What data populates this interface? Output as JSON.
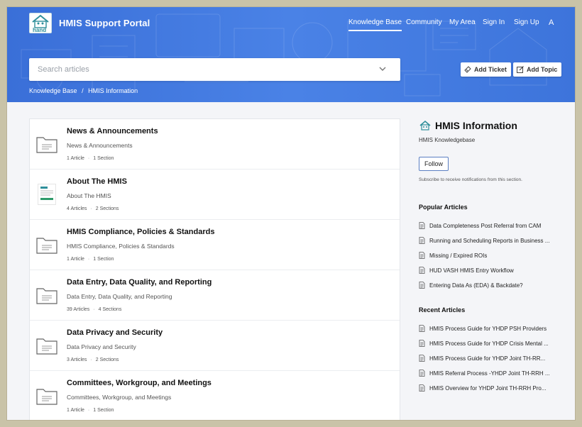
{
  "header": {
    "brand": "HMIS Support Portal",
    "nav": [
      "Knowledge Base",
      "Community",
      "My Area",
      "Sign In",
      "Sign Up"
    ],
    "active_nav": "Knowledge Base",
    "font_icon": "A",
    "accent": "#3d74db"
  },
  "search": {
    "placeholder": "Search articles"
  },
  "actions": {
    "add_ticket": "Add Ticket",
    "add_topic": "Add Topic"
  },
  "breadcrumb": {
    "root": "Knowledge Base",
    "sep": "/",
    "current": "HMIS Information"
  },
  "categories": [
    {
      "title": "News & Announcements",
      "desc": "News & Announcements",
      "articles": "1 Article",
      "sections": "1 Section",
      "icon": "folder-icon"
    },
    {
      "title": "About The HMIS",
      "desc": "About The HMIS",
      "articles": "4 Articles",
      "sections": "2 Sections",
      "icon": "thumbnail"
    },
    {
      "title": "HMIS Compliance, Policies & Standards",
      "desc": "HMIS Compliance, Policies & Standards",
      "articles": "1 Article",
      "sections": "1 Section",
      "icon": "folder-icon"
    },
    {
      "title": "Data Entry, Data Quality, and Reporting",
      "desc": "Data Entry, Data Quality, and Reporting",
      "articles": "39 Articles",
      "sections": "4 Sections",
      "icon": "folder-icon"
    },
    {
      "title": "Data Privacy and Security",
      "desc": "Data Privacy and Security",
      "articles": "3 Articles",
      "sections": "2 Sections",
      "icon": "folder-icon"
    },
    {
      "title": "Committees, Workgroup, and Meetings",
      "desc": "Committees, Workgroup, and Meetings",
      "articles": "1 Article",
      "sections": "1 Section",
      "icon": "folder-icon"
    }
  ],
  "sidebar": {
    "title": "HMIS Information",
    "subtitle": "HMIS Knowledgebase",
    "follow": "Follow",
    "note": "Subscribe to receive notifications from this section.",
    "popular_title": "Popular Articles",
    "popular": [
      "Data Completeness Post Referral from CAM",
      "Running and Scheduling Reports in Business ...",
      "Missing / Expired ROIs",
      "HUD VASH HMIS Entry Workflow",
      "Entering Data As (EDA) & Backdate?"
    ],
    "recent_title": "Recent Articles",
    "recent": [
      "HMIS Process Guide for YHDP PSH Providers",
      "HMIS Process Guide for YHDP Crisis Mental ...",
      "HMIS Process Guide for YHDP Joint TH-RR...",
      "HMIS Referral Process -YHDP Joint TH-RRH ...",
      "HMIS Overview for YHDP Joint TH-RRH Pro..."
    ]
  }
}
